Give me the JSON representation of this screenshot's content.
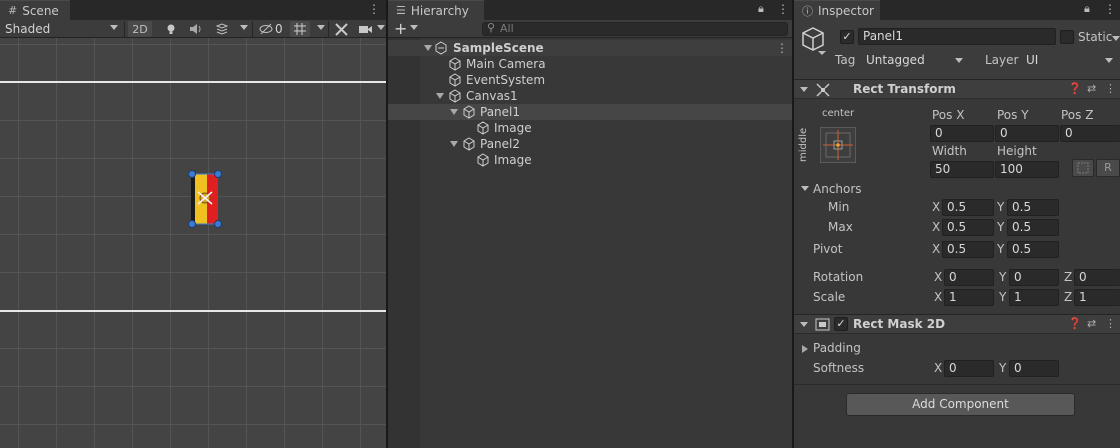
{
  "scene": {
    "tab_label": "Scene",
    "shading_mode": "Shaded",
    "toggle_2d": "2D",
    "hidden_count": "0"
  },
  "hierarchy": {
    "tab_label": "Hierarchy",
    "add_symbol": "+",
    "search_placeholder": "All",
    "items": [
      {
        "label": "SampleScene"
      },
      {
        "label": "Main Camera"
      },
      {
        "label": "EventSystem"
      },
      {
        "label": "Canvas1"
      },
      {
        "label": "Panel1"
      },
      {
        "label": "Image"
      },
      {
        "label": "Panel2"
      },
      {
        "label": "Image"
      }
    ]
  },
  "inspector": {
    "tab_label": "Inspector",
    "object_name": "Panel1",
    "static_label": "Static",
    "tag_label": "Tag",
    "tag_value": "Untagged",
    "layer_label": "Layer",
    "layer_value": "UI",
    "rect_transform": {
      "title": "Rect Transform",
      "anchor_h": "center",
      "anchor_v": "middle",
      "pos_x_label": "Pos X",
      "pos_x": "0",
      "pos_y_label": "Pos Y",
      "pos_y": "0",
      "pos_z_label": "Pos Z",
      "pos_z": "0",
      "width_label": "Width",
      "width": "50",
      "height_label": "Height",
      "height": "100",
      "raw_button": "R",
      "anchors_label": "Anchors",
      "min_label": "Min",
      "min_x": "0.5",
      "min_y": "0.5",
      "max_label": "Max",
      "max_x": "0.5",
      "max_y": "0.5",
      "pivot_label": "Pivot",
      "pivot_x": "0.5",
      "pivot_y": "0.5",
      "rotation_label": "Rotation",
      "rot_x": "0",
      "rot_y": "0",
      "rot_z": "0",
      "scale_label": "Scale",
      "scale_x": "1",
      "scale_y": "1",
      "scale_z": "1",
      "x_label": "X",
      "y_label": "Y",
      "z_label": "Z"
    },
    "rect_mask": {
      "title": "Rect Mask 2D",
      "padding_label": "Padding",
      "softness_label": "Softness",
      "softness_x": "0",
      "softness_y": "0"
    },
    "add_component": "Add Component"
  },
  "colors": {
    "panel_bg": "#383838",
    "selection": "#464646",
    "handle_blue": "#3a7bd5",
    "flag_red": "#e02020",
    "flag_yellow": "#f0c020"
  }
}
